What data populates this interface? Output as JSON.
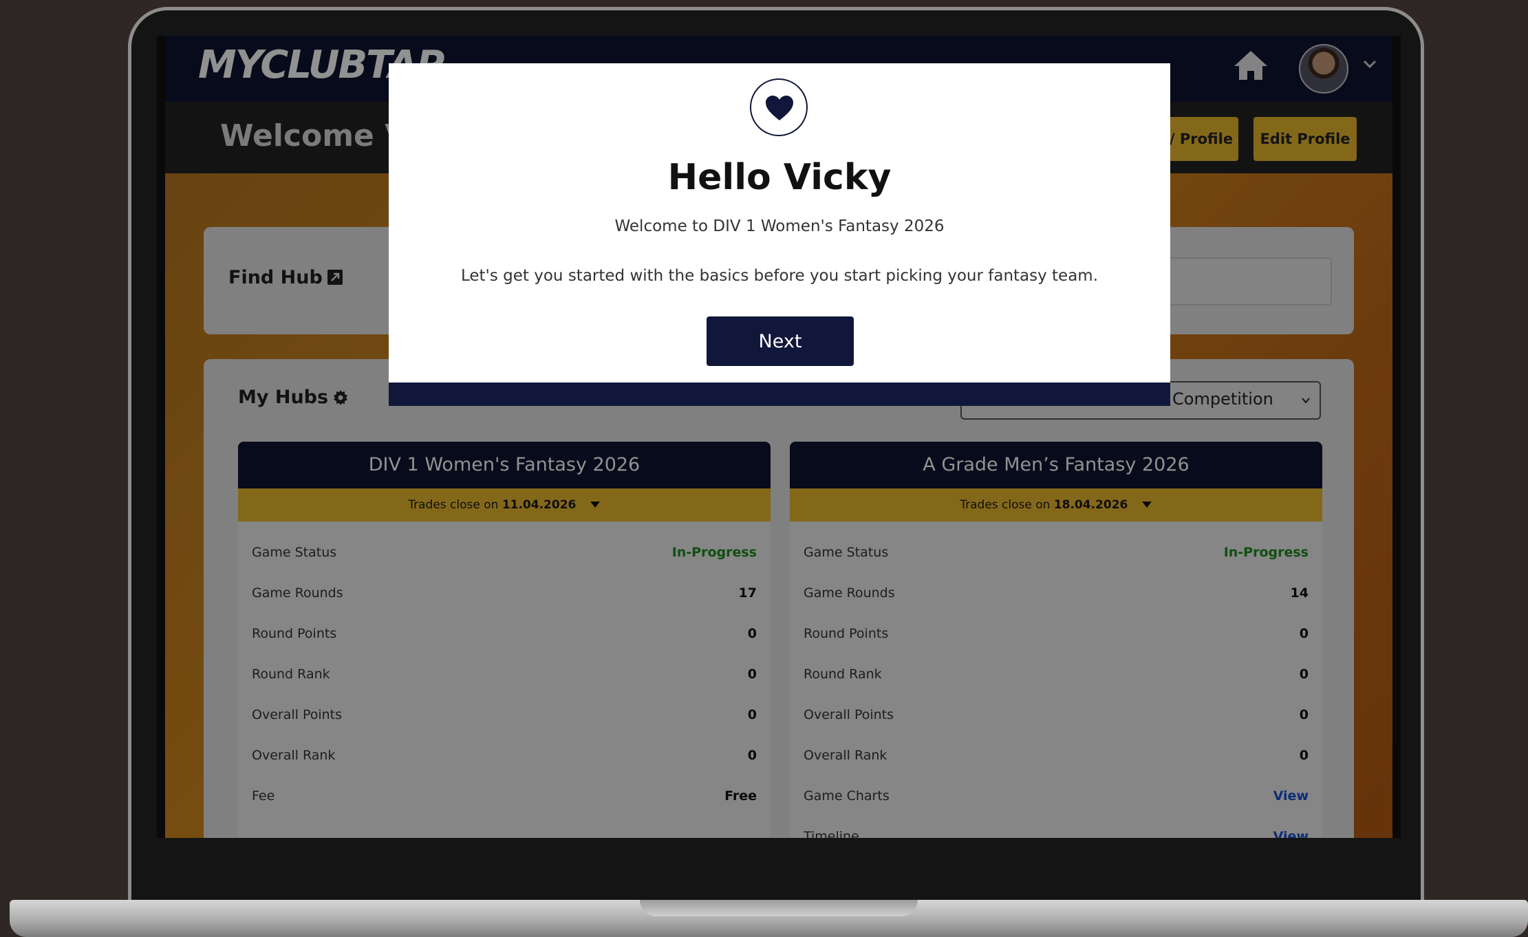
{
  "app": {
    "logo_text": "MYCLUBTAP",
    "welcome_text": "Welcome V",
    "my_profile_label": "/ Profile",
    "edit_profile_label": "Edit Profile"
  },
  "find_hub": {
    "label": "Find Hub"
  },
  "my_hubs": {
    "label": "My Hubs",
    "competition_select": "Competition",
    "hubs": [
      {
        "title": "DIV 1 Women's Fantasy 2026",
        "trades_prefix": "Trades close on",
        "trades_date": "11.04.2026",
        "rows": [
          {
            "label": "Game Status",
            "value": "In-Progress"
          },
          {
            "label": "Game Rounds",
            "value": "17"
          },
          {
            "label": "Round Points",
            "value": "0"
          },
          {
            "label": "Round Rank",
            "value": "0"
          },
          {
            "label": "Overall Points",
            "value": "0"
          },
          {
            "label": "Overall Rank",
            "value": "0"
          },
          {
            "label": "Fee",
            "value": "Free"
          }
        ]
      },
      {
        "title": "A Grade Men’s Fantasy 2026",
        "trades_prefix": "Trades close on",
        "trades_date": "18.04.2026",
        "rows": [
          {
            "label": "Game Status",
            "value": "In-Progress"
          },
          {
            "label": "Game Rounds",
            "value": "14"
          },
          {
            "label": "Round Points",
            "value": "0"
          },
          {
            "label": "Round Rank",
            "value": "0"
          },
          {
            "label": "Overall Points",
            "value": "0"
          },
          {
            "label": "Overall Rank",
            "value": "0"
          },
          {
            "label": "Game Charts",
            "value": "View"
          },
          {
            "label": "Timeline",
            "value": "View"
          }
        ]
      }
    ]
  },
  "modal": {
    "title": "Hello Vicky",
    "subtitle": "Welcome to DIV 1 Women's Fantasy 2026",
    "body": "Let's get you started with the basics before you start picking your fantasy team.",
    "next_label": "Next"
  },
  "colors": {
    "navy": "#10173a",
    "gold": "#e9b82e",
    "status_green": "#1f8a1f",
    "link_blue": "#1a4ecf"
  },
  "icons": [
    "heart-icon",
    "home-icon",
    "chevron-down-icon",
    "gear-icon",
    "external-link-icon",
    "avatar"
  ]
}
